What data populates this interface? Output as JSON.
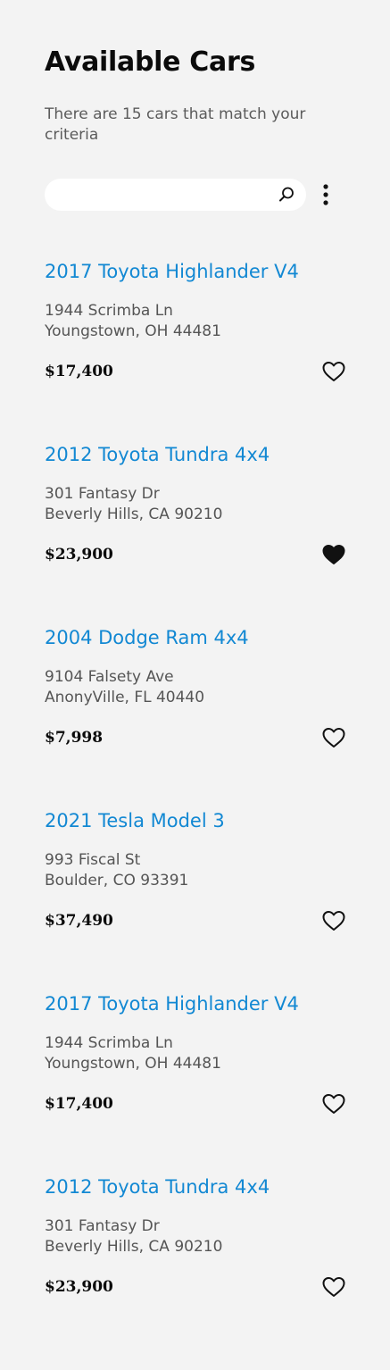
{
  "header": {
    "title": "Available Cars",
    "subtitle": "There are 15 cars that match your criteria"
  },
  "search": {
    "value": "",
    "placeholder": "",
    "icon": "search-icon",
    "menu_icon": "more-vertical-icon"
  },
  "listings": [
    {
      "title": "2017 Toyota Highlander V4",
      "address_line1": "1944 Scrimba Ln",
      "address_line2": "Youngstown, OH 44481",
      "price": "$17,400",
      "favorited": false
    },
    {
      "title": "2012 Toyota Tundra 4x4",
      "address_line1": "301 Fantasy Dr",
      "address_line2": "Beverly Hills, CA 90210",
      "price": "$23,900",
      "favorited": true
    },
    {
      "title": "2004 Dodge Ram 4x4",
      "address_line1": "9104 Falsety Ave",
      "address_line2": "AnonyVille, FL 40440",
      "price": "$7,998",
      "favorited": false
    },
    {
      "title": "2021 Tesla Model 3",
      "address_line1": "993 Fiscal St",
      "address_line2": "Boulder, CO 93391",
      "price": "$37,490",
      "favorited": false
    },
    {
      "title": "2017 Toyota Highlander V4",
      "address_line1": "1944 Scrimba Ln",
      "address_line2": "Youngstown, OH 44481",
      "price": "$17,400",
      "favorited": false
    },
    {
      "title": "2012 Toyota Tundra 4x4",
      "address_line1": "301 Fantasy Dr",
      "address_line2": "Beverly Hills, CA 90210",
      "price": "$23,900",
      "favorited": false
    }
  ],
  "colors": {
    "background": "#f3f3f3",
    "title_link": "#1288d3",
    "heart": "#111111"
  }
}
